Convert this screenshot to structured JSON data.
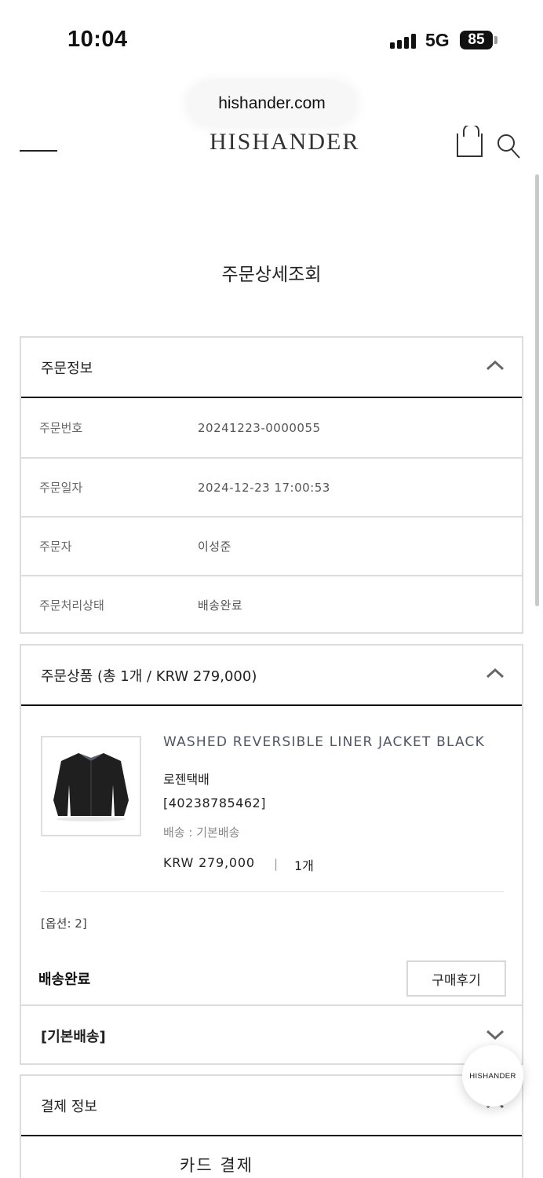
{
  "status_bar": {
    "time": "10:04",
    "network": "5G",
    "battery": "85"
  },
  "browser": {
    "url": "hishander.com"
  },
  "header": {
    "logo": "HISHANDER"
  },
  "page": {
    "title": "주문상세조회"
  },
  "order_info": {
    "heading": "주문정보",
    "rows": [
      {
        "label": "주문번호",
        "value": "20241223-0000055"
      },
      {
        "label": "주문일자",
        "value": "2024-12-23 17:00:53"
      },
      {
        "label": "주문자",
        "value": "이성준"
      },
      {
        "label": "주문처리상태",
        "value": "배송완료"
      }
    ]
  },
  "order_items": {
    "heading": "주문상품 (총 1개 / KRW 279,000)",
    "product": {
      "name": "WASHED REVERSIBLE LINER JACKET BLACK",
      "carrier": "로젠택배",
      "tracking": "[40238785462]",
      "shipping": "배송 : 기본배송",
      "price": "KRW 279,000",
      "separator": "|",
      "quantity": "1개",
      "option": "[옵션: 2]",
      "status": "배송완료",
      "review_button": "구매후기"
    }
  },
  "shipping_section": {
    "heading": "[기본배송]"
  },
  "payment": {
    "heading": "결제 정보",
    "method": "카드 결제"
  },
  "floating": {
    "label": "HISHANDER"
  }
}
